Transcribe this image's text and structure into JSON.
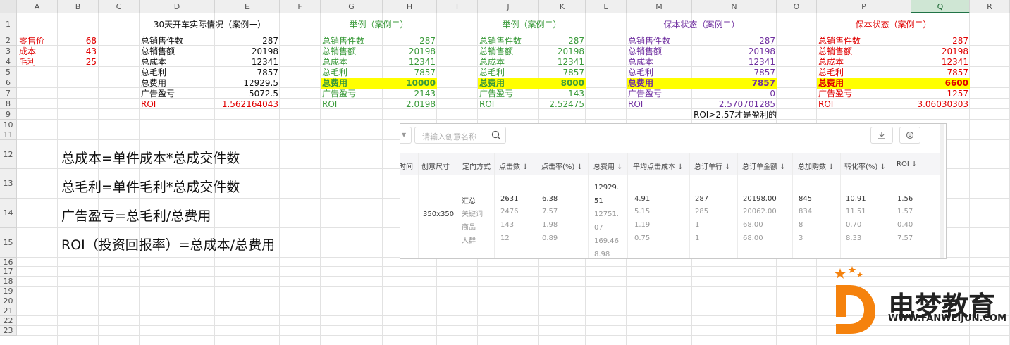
{
  "columns": [
    "A",
    "B",
    "C",
    "D",
    "E",
    "F",
    "G",
    "H",
    "I",
    "J",
    "K",
    "L",
    "M",
    "N",
    "O",
    "P",
    "Q",
    "R"
  ],
  "rows": [
    "1",
    "2",
    "3",
    "4",
    "5",
    "6",
    "7",
    "8",
    "9",
    "10",
    "11",
    "12",
    "13",
    "14",
    "15",
    "16",
    "17",
    "18",
    "19",
    "20",
    "21",
    "22",
    "23"
  ],
  "selected_column": "Q",
  "colors": {
    "red": "#e00000",
    "green": "#3a9a3a",
    "purple": "#7030a0",
    "black": "#111111",
    "highlight": "#ffff00",
    "logo_orange": "#f5820d"
  },
  "unit_prices": [
    {
      "label": "零售价",
      "value": "68"
    },
    {
      "label": "成本",
      "value": "43"
    },
    {
      "label": "毛利",
      "value": "25"
    }
  ],
  "case1": {
    "title": "30天开车实际情况（案例一）",
    "rows": [
      {
        "label": "总销售件数",
        "value": "287"
      },
      {
        "label": "总销售额",
        "value": "20198"
      },
      {
        "label": "总成本",
        "value": "12341"
      },
      {
        "label": "总毛利",
        "value": "7857"
      },
      {
        "label": "总费用",
        "value": "12929.5"
      },
      {
        "label": "广告盈亏",
        "value": "-5072.5"
      },
      {
        "label": "ROI",
        "value": "1.562164043"
      }
    ]
  },
  "case2a": {
    "title": "举例（案例二）",
    "rows": [
      {
        "label": "总销售件数",
        "value": "287"
      },
      {
        "label": "总销售额",
        "value": "20198"
      },
      {
        "label": "总成本",
        "value": "12341"
      },
      {
        "label": "总毛利",
        "value": "7857"
      },
      {
        "label": "总费用",
        "value": "10000"
      },
      {
        "label": "广告盈亏",
        "value": "-2143"
      },
      {
        "label": "ROI",
        "value": "2.0198"
      }
    ]
  },
  "case2b": {
    "title": "举例（案例二）",
    "rows": [
      {
        "label": "总销售件数",
        "value": "287"
      },
      {
        "label": "总销售额",
        "value": "20198"
      },
      {
        "label": "总成本",
        "value": "12341"
      },
      {
        "label": "总毛利",
        "value": "7857"
      },
      {
        "label": "总费用",
        "value": "8000"
      },
      {
        "label": "广告盈亏",
        "value": "-143"
      },
      {
        "label": "ROI",
        "value": "2.52475"
      }
    ]
  },
  "case_break_even": {
    "title": "保本状态（案例二）",
    "rows": [
      {
        "label": "总销售件数",
        "value": "287"
      },
      {
        "label": "总销售额",
        "value": "20198"
      },
      {
        "label": "总成本",
        "value": "12341"
      },
      {
        "label": "总毛利",
        "value": "7857"
      },
      {
        "label": "总费用",
        "value": "7857"
      },
      {
        "label": "广告盈亏",
        "value": "0"
      },
      {
        "label": "ROI",
        "value": "2.570701285"
      }
    ],
    "note": "ROI>2.57才是盈利的"
  },
  "case_break_even2": {
    "title": "保本状态（案例二）",
    "rows": [
      {
        "label": "总销售件数",
        "value": "287"
      },
      {
        "label": "总销售额",
        "value": "20198"
      },
      {
        "label": "总成本",
        "value": "12341"
      },
      {
        "label": "总毛利",
        "value": "7857"
      },
      {
        "label": "总费用",
        "value": "6600"
      },
      {
        "label": "广告盈亏",
        "value": "1257"
      },
      {
        "label": "ROI",
        "value": "3.06030303"
      }
    ]
  },
  "formulas": [
    "总成本=单件成本*总成交件数",
    "总毛利=单件毛利*总成交件数",
    "广告盈亏=总毛利/总费用",
    "ROI（投资回报率）=总成本/总费用"
  ],
  "panel": {
    "search_placeholder": "请输入创意名称",
    "headers": [
      "时间",
      "创意尺寸",
      "定向方式",
      "点击数 ↓",
      "点击率(%) ↓",
      "总费用 ↓",
      "平均点击成本 ↓",
      "总订单行 ↓",
      "总订单金额 ↓",
      "总加购数 ↓",
      "转化率(%) ↓",
      "ROI ↓"
    ],
    "size": "350x350",
    "groups": [
      "汇总",
      "关键词",
      "商品",
      "人群"
    ],
    "clicks": [
      "2631",
      "2476",
      "143",
      "12"
    ],
    "ctr": [
      "6.38",
      "7.57",
      "1.98",
      "0.89"
    ],
    "cost": [
      "12929.51",
      "12751.07",
      "169.46",
      "8.98"
    ],
    "cpc": [
      "4.91",
      "5.15",
      "1.19",
      "0.75"
    ],
    "orders": [
      "287",
      "285",
      "1",
      "1"
    ],
    "amount": [
      "20198.00",
      "20062.00",
      "68.00",
      "68.00"
    ],
    "carts": [
      "845",
      "834",
      "8",
      "3"
    ],
    "conv": [
      "10.91",
      "11.51",
      "0.70",
      "8.33"
    ],
    "roi": [
      "1.56",
      "1.57",
      "0.40",
      "7.57"
    ]
  },
  "logo": {
    "name": "电梦教育",
    "url": "WWW.FANWEIJUN.COM"
  }
}
